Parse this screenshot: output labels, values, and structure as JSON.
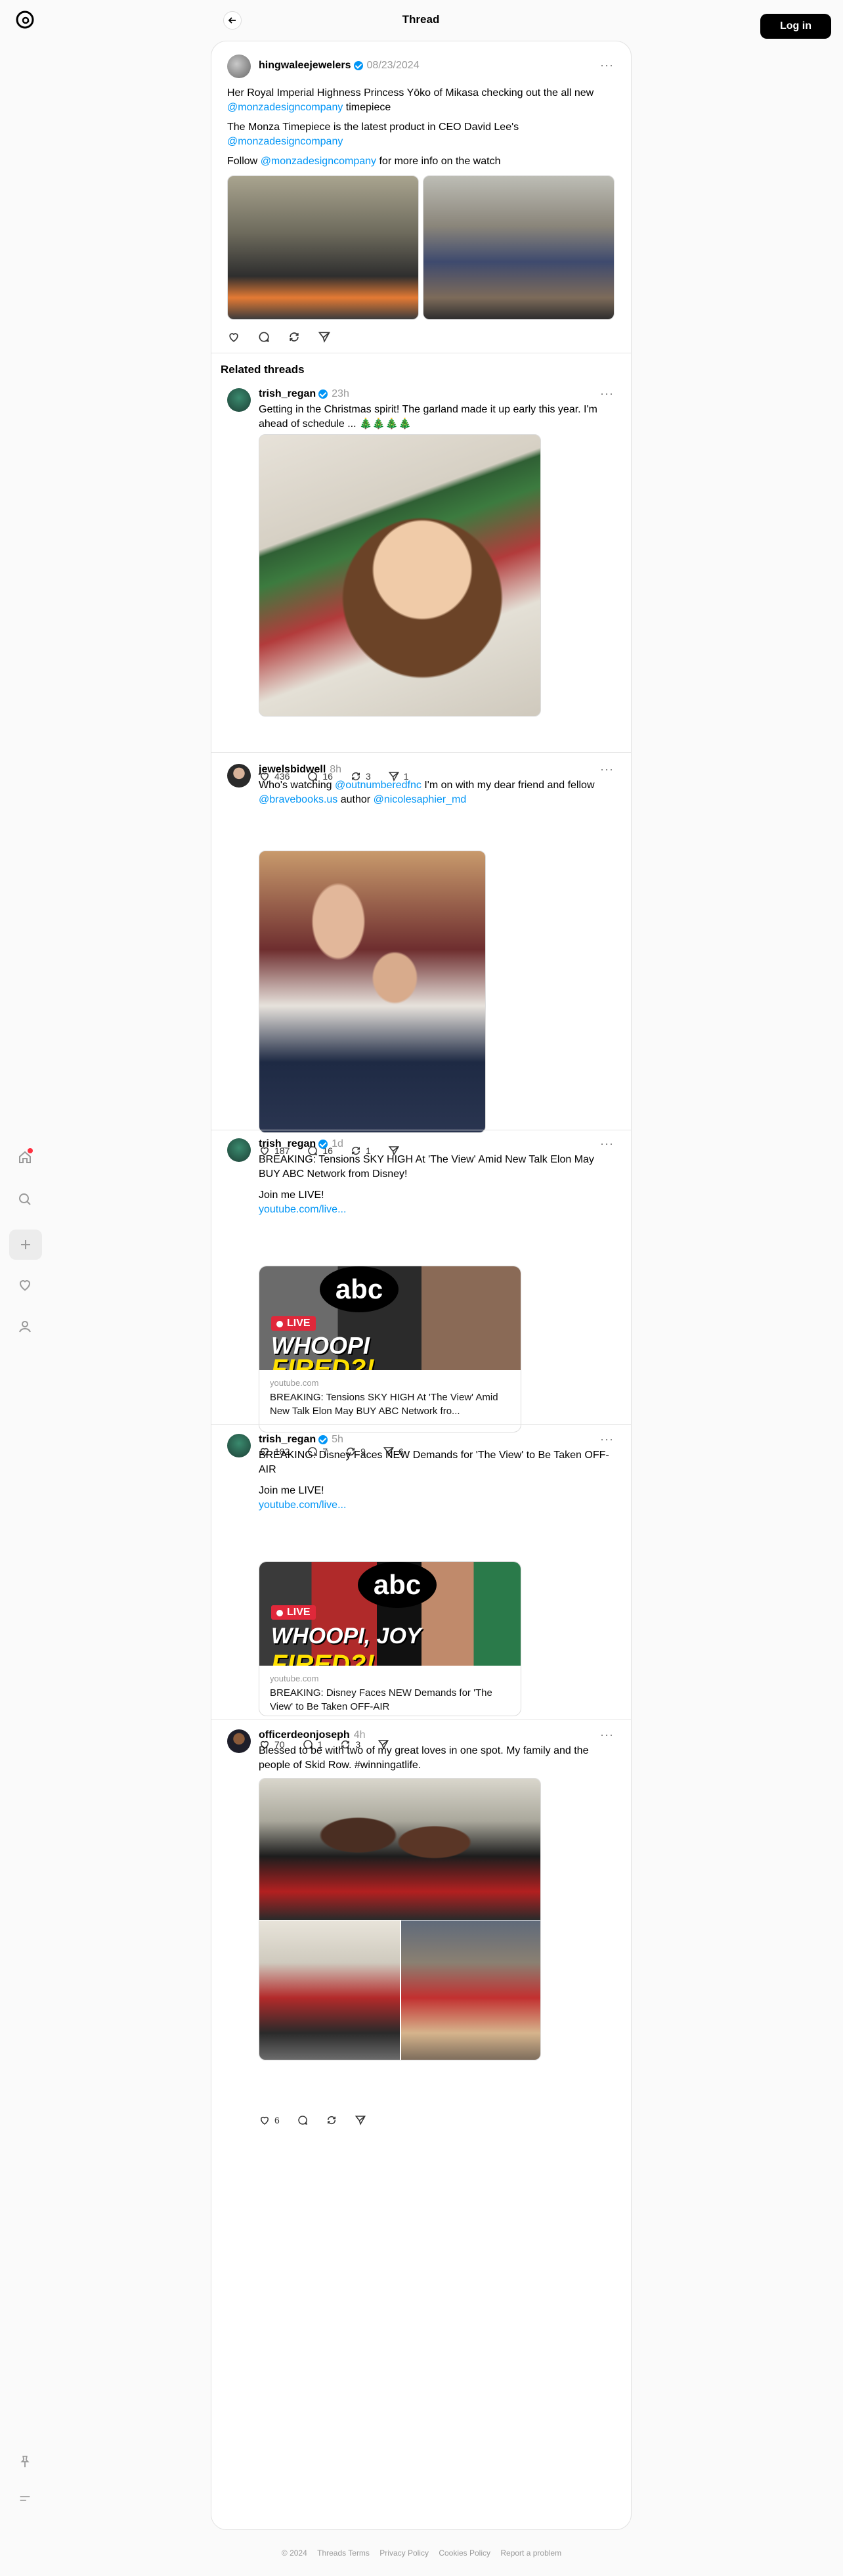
{
  "topbar": {
    "title": "Thread",
    "login_label": "Log in"
  },
  "main_post": {
    "username": "hingwaleejewelers",
    "date": "08/23/2024",
    "para1_pre": "Her Royal Imperial Highness Princess Yōko of Mikasa checking out the all new ",
    "para1_link": "@monzadesigncompany",
    "para1_post": " timepiece",
    "para2_pre": "The Monza Timepiece is the latest product in CEO David Lee's ",
    "para2_link": "@monzadesigncompany",
    "para3_pre": "Follow ",
    "para3_link": "@monzadesigncompany",
    "para3_post": " for more info on the watch"
  },
  "related": {
    "title": "Related threads"
  },
  "posts": [
    {
      "username": "trish_regan",
      "time": "23h",
      "text": "Getting in the Christmas spirit! The garland made it up early this year. I'm ahead of schedule ... 🎄🎄🎄🎄",
      "likes": "436",
      "replies": "16",
      "reposts": "3",
      "shares": "1"
    },
    {
      "username": "jewelsbidwell",
      "time": "8h",
      "text_pre": "Who's watching ",
      "link1": "@outnumberedfnc",
      "text_mid": " I'm on with my dear friend and fellow ",
      "link2": "@bravebooks.us",
      "text_mid2": " author ",
      "link3": "@nicolesaphier_md",
      "likes": "187",
      "replies": "16",
      "reposts": "1"
    },
    {
      "username": "trish_regan",
      "time": "1d",
      "text": "BREAKING: Tensions SKY HIGH At 'The View' Amid New Talk Elon May BUY ABC Network from Disney!",
      "text2": "Join me LIVE!",
      "link": "youtube.com/live...",
      "card_domain": "youtube.com",
      "card_title": "BREAKING: Tensions SKY HIGH At 'The View' Amid New Talk Elon May BUY ABC Network fro...",
      "thumb_big": "WHOOPI",
      "thumb_big2": "FIRED?!",
      "likes": "182",
      "replies": "7",
      "reposts": "9",
      "shares": "6"
    },
    {
      "username": "trish_regan",
      "time": "5h",
      "text": "BREAKING: Disney Faces NEW Demands for 'The View' to Be Taken OFF-AIR",
      "text2": "Join me LIVE!",
      "link": "youtube.com/live...",
      "card_domain": "youtube.com",
      "card_title": "BREAKING: Disney Faces NEW Demands for 'The View' to Be Taken OFF-AIR",
      "thumb_big": "WHOOPI, JOY",
      "thumb_big2": "FIRED?!",
      "likes": "70",
      "replies": "1",
      "reposts": "3"
    },
    {
      "username": "officerdeonjoseph",
      "time": "4h",
      "text": "Blessed to be with two of my great loves in one spot. My family and the people of Skid Row. #winningatlife.",
      "likes": "6"
    }
  ],
  "live_badge": "LIVE",
  "abc": "abc",
  "footer": {
    "copyright": "© 2024",
    "terms": "Threads Terms",
    "privacy": "Privacy Policy",
    "cookies": "Cookies Policy",
    "report": "Report a problem"
  },
  "colors": {
    "accent": "#0095f6",
    "live": "#e0283a"
  }
}
